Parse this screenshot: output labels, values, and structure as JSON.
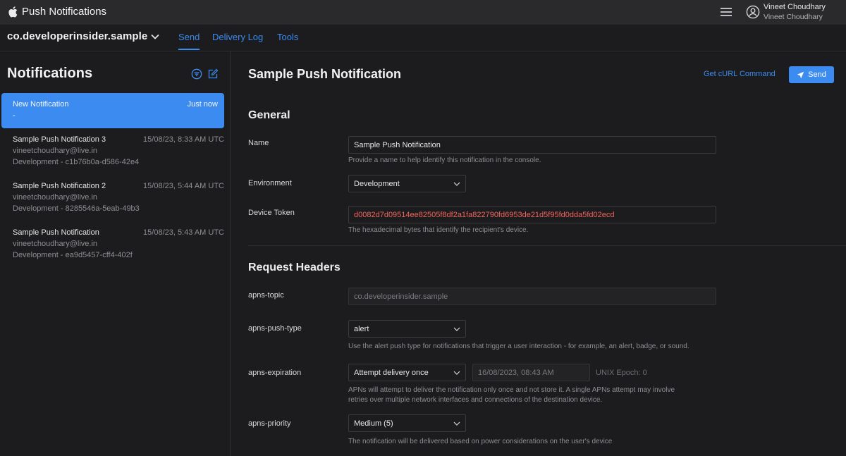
{
  "app": {
    "title": "Push Notifications"
  },
  "user": {
    "name": "Vineet Choudhary",
    "subname": "Vineet Choudhary"
  },
  "subbar": {
    "team": "co.developerinsider.sample",
    "tabs": [
      {
        "label": "Send"
      },
      {
        "label": "Delivery Log"
      },
      {
        "label": "Tools"
      }
    ]
  },
  "sidebar": {
    "title": "Notifications",
    "selected": {
      "title": "New Notification",
      "time": "Just now",
      "sub": "-"
    },
    "items": [
      {
        "title": "Sample Push Notification 3",
        "date": "15/08/23, 8:33 AM UTC",
        "email": "vineetchoudhary@live.in",
        "env": "Development - c1b76b0a-d586-42e4"
      },
      {
        "title": "Sample Push Notification 2",
        "date": "15/08/23, 5:44 AM UTC",
        "email": "vineetchoudhary@live.in",
        "env": "Development - 8285546a-5eab-49b3"
      },
      {
        "title": "Sample Push Notification",
        "date": "15/08/23, 5:43 AM UTC",
        "email": "vineetchoudhary@live.in",
        "env": "Development - ea9d5457-cff4-402f"
      }
    ]
  },
  "main": {
    "title": "Sample Push Notification",
    "curl_label": "Get cURL Command",
    "send_label": "Send",
    "general": {
      "heading": "General",
      "name_label": "Name",
      "name_value": "Sample Push Notification",
      "name_help": "Provide a name to help identify this notification in the console.",
      "env_label": "Environment",
      "env_value": "Development",
      "token_label": "Device Token",
      "token_value": "d0082d7d09514ee82505f8df2a1fa822790fd6953de21d5f95fd0dda5fd02ecd",
      "token_help": "The hexadecimal bytes that identify the recipient's device."
    },
    "headers": {
      "heading": "Request Headers",
      "topic_label": "apns-topic",
      "topic_value": "co.developerinsider.sample",
      "push_type_label": "apns-push-type",
      "push_type_value": "alert",
      "push_type_help": "Use the alert push type for notifications that trigger a user interaction - for example, an alert, badge, or sound.",
      "expiration_label": "apns-expiration",
      "expiration_value": "Attempt delivery once",
      "expiration_date": "16/08/2023, 08:43 AM",
      "expiration_epoch": "UNIX Epoch: 0",
      "expiration_help_1": "APNs will attempt to deliver the notification only once and not store it. A single APNs attempt may involve",
      "expiration_help_2": "retries over multiple network interfaces and connections of the destination device.",
      "priority_label": "apns-priority",
      "priority_value": "Medium (5)",
      "priority_help": "The notification will be delivered based on power considerations on the user's device"
    }
  },
  "colors": {
    "accent": "#3b8bf0",
    "token_text": "#f0645c",
    "background": "#1c1c1e",
    "topbar": "#2a2a2c"
  },
  "icons": [
    "apple-logo-icon",
    "hamburger-menu-icon",
    "user-account-icon",
    "chevron-down-icon",
    "filter-icon",
    "compose-icon",
    "paper-plane-icon"
  ]
}
